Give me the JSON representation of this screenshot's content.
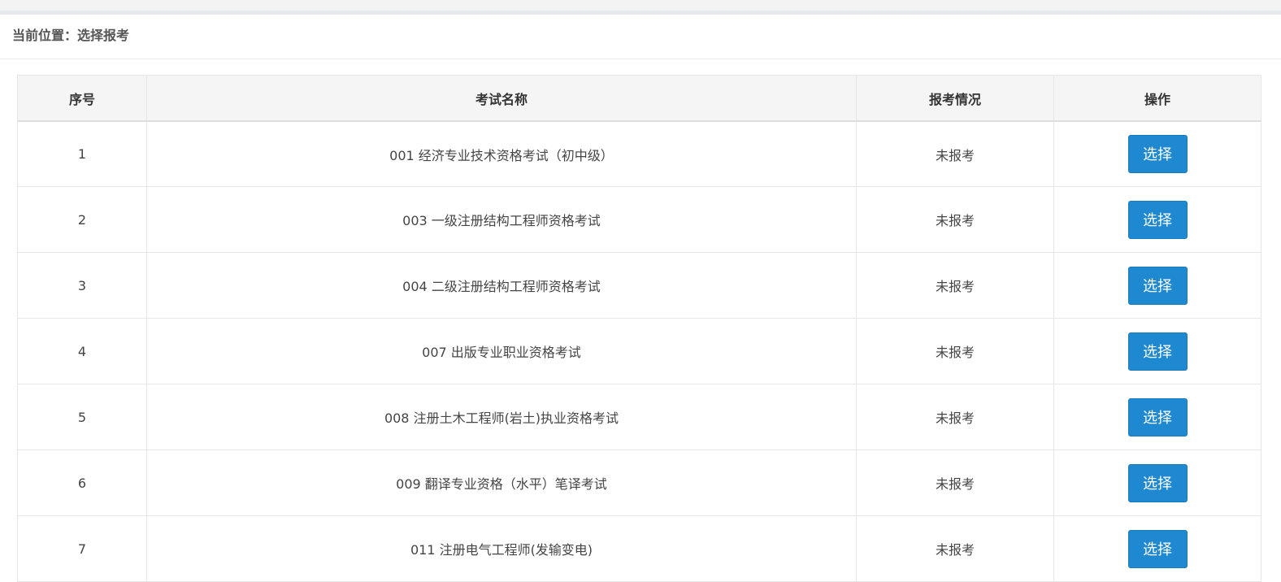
{
  "breadcrumb": {
    "label": "当前位置：",
    "current": "选择报考"
  },
  "table": {
    "headers": [
      "序号",
      "考试名称",
      "报考情况",
      "操作"
    ],
    "rows": [
      {
        "index": "1",
        "name": "001 经济专业技术资格考试（初中级）",
        "status": "未报考",
        "action": "选择"
      },
      {
        "index": "2",
        "name": "003 一级注册结构工程师资格考试",
        "status": "未报考",
        "action": "选择"
      },
      {
        "index": "3",
        "name": "004 二级注册结构工程师资格考试",
        "status": "未报考",
        "action": "选择"
      },
      {
        "index": "4",
        "name": "007 出版专业职业资格考试",
        "status": "未报考",
        "action": "选择"
      },
      {
        "index": "5",
        "name": "008 注册土木工程师(岩土)执业资格考试",
        "status": "未报考",
        "action": "选择"
      },
      {
        "index": "6",
        "name": "009 翻译专业资格（水平）笔译考试",
        "status": "未报考",
        "action": "选择"
      },
      {
        "index": "7",
        "name": "011 注册电气工程师(发输变电)",
        "status": "未报考",
        "action": "选择"
      }
    ]
  },
  "colors": {
    "button_bg": "#1e88d0",
    "header_bg": "#f5f5f5",
    "border": "#e6e6e6"
  }
}
